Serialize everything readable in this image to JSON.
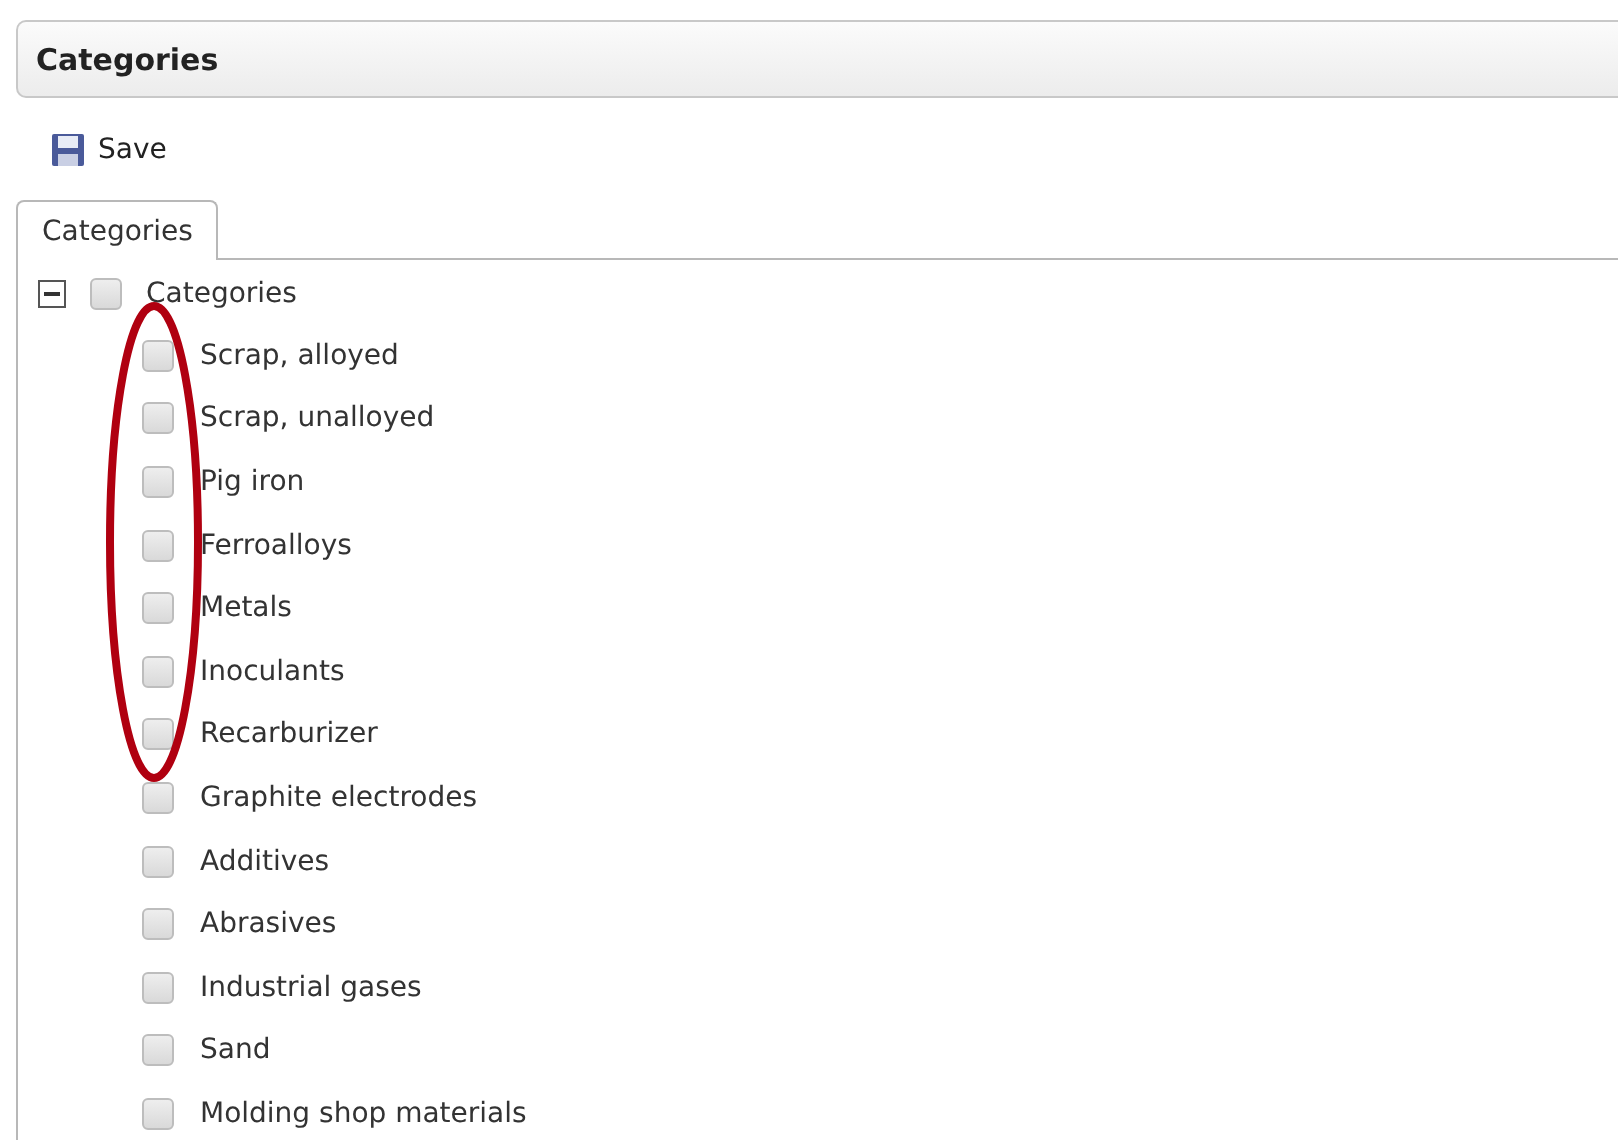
{
  "panel": {
    "title": "Categories"
  },
  "toolbar": [
    {
      "label": "Save"
    }
  ],
  "tabs": [
    {
      "label": "Categories",
      "selected": true
    }
  ],
  "tree": [
    {
      "label": "Categories",
      "checked": false,
      "expanded": true,
      "children": [
        {
          "label": "Scrap, alloyed",
          "checked": false
        },
        {
          "label": "Scrap, unalloyed",
          "checked": false
        },
        {
          "label": "Pig iron",
          "checked": false
        },
        {
          "label": "Ferroalloys",
          "checked": false
        },
        {
          "label": "Metals",
          "checked": false
        },
        {
          "label": "Inoculants",
          "checked": false
        },
        {
          "label": "Recarburizer",
          "checked": false
        },
        {
          "label": "Graphite electrodes",
          "checked": false
        },
        {
          "label": "Additives",
          "checked": false
        },
        {
          "label": "Abrasives",
          "checked": false
        },
        {
          "label": "Industrial gases",
          "checked": false
        },
        {
          "label": "Sand",
          "checked": false
        },
        {
          "label": "Molding shop materials",
          "checked": false
        }
      ]
    }
  ]
}
